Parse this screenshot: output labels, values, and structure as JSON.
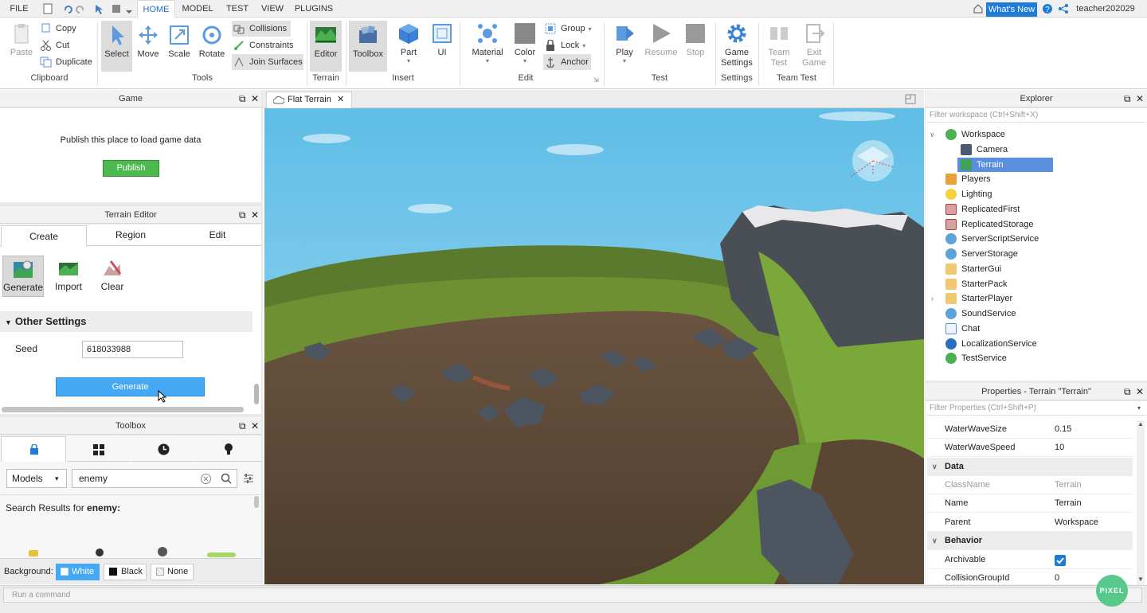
{
  "menubar": {
    "file": "FILE",
    "tabs": [
      "HOME",
      "MODEL",
      "TEST",
      "VIEW",
      "PLUGINS"
    ],
    "whats_new": "What's New",
    "user": "teacher202029"
  },
  "ribbon": {
    "clipboard": {
      "paste": "Paste",
      "copy": "Copy",
      "cut": "Cut",
      "duplicate": "Duplicate",
      "label": "Clipboard"
    },
    "tools": {
      "select": "Select",
      "move": "Move",
      "scale": "Scale",
      "rotate": "Rotate",
      "collisions": "Collisions",
      "constraints": "Constraints",
      "join_surfaces": "Join Surfaces",
      "label": "Tools"
    },
    "terrain": {
      "editor": "Editor",
      "label": "Terrain"
    },
    "insert": {
      "toolbox": "Toolbox",
      "part": "Part",
      "ui": "UI",
      "label": "Insert"
    },
    "edit": {
      "material": "Material",
      "color": "Color",
      "group": "Group",
      "lock": "Lock",
      "anchor": "Anchor",
      "label": "Edit"
    },
    "test": {
      "play": "Play",
      "resume": "Resume",
      "stop": "Stop",
      "label": "Test"
    },
    "settings": {
      "game_settings_1": "Game",
      "game_settings_2": "Settings",
      "label": "Settings"
    },
    "team_test": {
      "team_test_1": "Team",
      "team_test_2": "Test",
      "exit_game_1": "Exit",
      "exit_game_2": "Game",
      "label": "Team Test"
    }
  },
  "game_panel": {
    "title": "Game",
    "message": "Publish this place to load game data",
    "publish": "Publish"
  },
  "terrain_editor": {
    "title": "Terrain Editor",
    "tabs": [
      "Create",
      "Region",
      "Edit"
    ],
    "tools": [
      "Generate",
      "Import",
      "Clear"
    ],
    "section": "Other Settings",
    "seed_label": "Seed",
    "seed_value": "618033988",
    "generate_button": "Generate"
  },
  "toolbox": {
    "title": "Toolbox",
    "category": "Models",
    "search_value": "enemy",
    "results_prefix": "Search Results for ",
    "results_term": "enemy:",
    "background_label": "Background:",
    "bg_options": [
      "White",
      "Black",
      "None"
    ]
  },
  "viewport": {
    "tab": "Flat Terrain"
  },
  "explorer": {
    "title": "Explorer",
    "filter_placeholder": "Filter workspace (Ctrl+Shift+X)",
    "items": [
      "Workspace",
      "Camera",
      "Terrain",
      "Players",
      "Lighting",
      "ReplicatedFirst",
      "ReplicatedStorage",
      "ServerScriptService",
      "ServerStorage",
      "StarterGui",
      "StarterPack",
      "StarterPlayer",
      "SoundService",
      "Chat",
      "LocalizationService",
      "TestService"
    ]
  },
  "properties": {
    "title": "Properties - Terrain \"Terrain\"",
    "filter_placeholder": "Filter Properties (Ctrl+Shift+P)",
    "rows": [
      {
        "name": "WaterWaveSize",
        "value": "0.15"
      },
      {
        "name": "WaterWaveSpeed",
        "value": "10"
      }
    ],
    "cat_data": "Data",
    "data_rows": [
      {
        "name": "ClassName",
        "value": "Terrain"
      },
      {
        "name": "Name",
        "value": "Terrain"
      },
      {
        "name": "Parent",
        "value": "Workspace"
      }
    ],
    "cat_behavior": "Behavior",
    "behavior_rows": [
      {
        "name": "Archivable",
        "value": ""
      },
      {
        "name": "CollisionGroupId",
        "value": "0"
      }
    ]
  },
  "command_bar": {
    "placeholder": "Run a command"
  },
  "watermark": "PIXEL",
  "colors": {
    "accent": "#1e7bd8",
    "publish_green": "#4cba4f",
    "generate_blue": "#45a8f4",
    "selection": "#5b8fdc"
  }
}
